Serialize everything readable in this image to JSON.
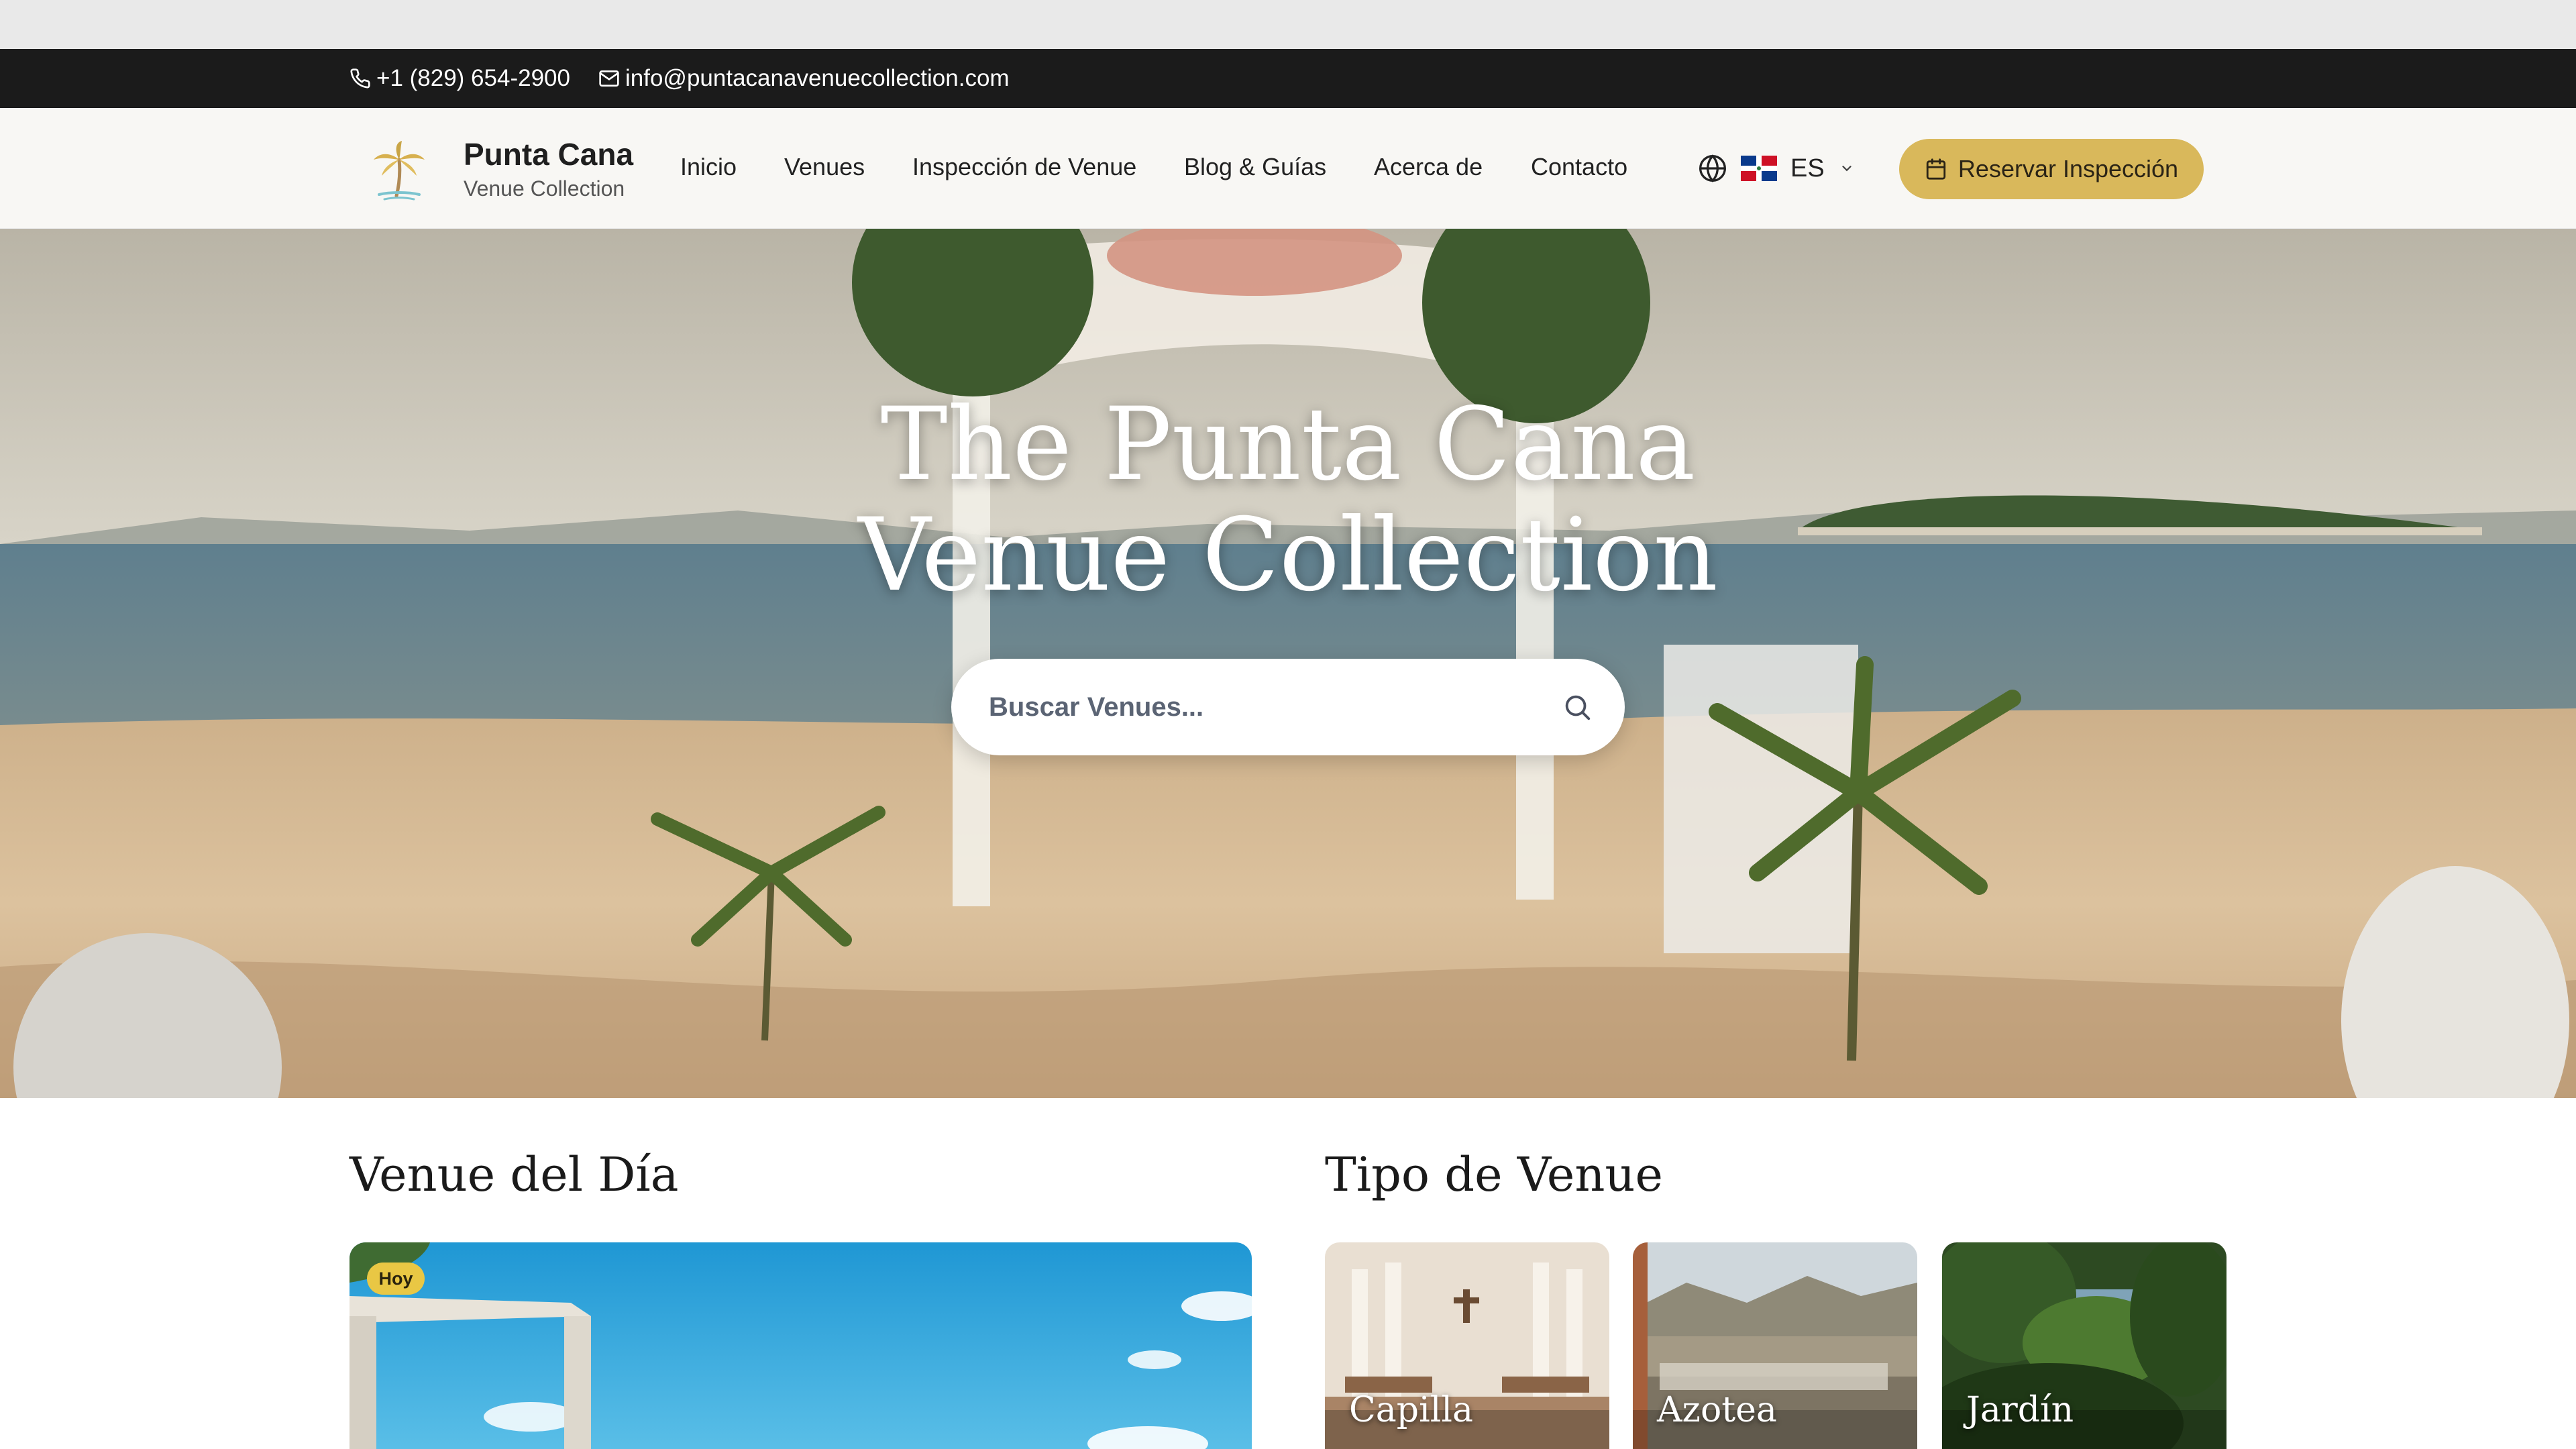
{
  "topbar": {
    "phone": "+1 (829) 654-2900",
    "email": "info@puntacanavenuecollection.com"
  },
  "brand": {
    "title": "Punta Cana",
    "subtitle": "Venue Collection"
  },
  "nav": {
    "items": [
      {
        "label": "Inicio"
      },
      {
        "label": "Venues"
      },
      {
        "label": "Inspección de Venue"
      },
      {
        "label": "Blog & Guías"
      },
      {
        "label": "Acerca de"
      },
      {
        "label": "Contacto"
      }
    ],
    "language": "ES",
    "cta_label": "Reservar Inspección"
  },
  "hero": {
    "title_line1": "The Punta Cana",
    "title_line2": "Venue Collection",
    "search_placeholder": "Buscar Venues..."
  },
  "venue_of_day": {
    "heading": "Venue del Día",
    "badge": "Hoy"
  },
  "venue_types": {
    "heading": "Tipo de Venue",
    "items": [
      {
        "label": "Capilla"
      },
      {
        "label": "Azotea"
      },
      {
        "label": "Jardín"
      }
    ]
  },
  "colors": {
    "accent": "#d9b85b",
    "topbar": "#1b1b1b",
    "header_bg": "#f8f7f4"
  }
}
